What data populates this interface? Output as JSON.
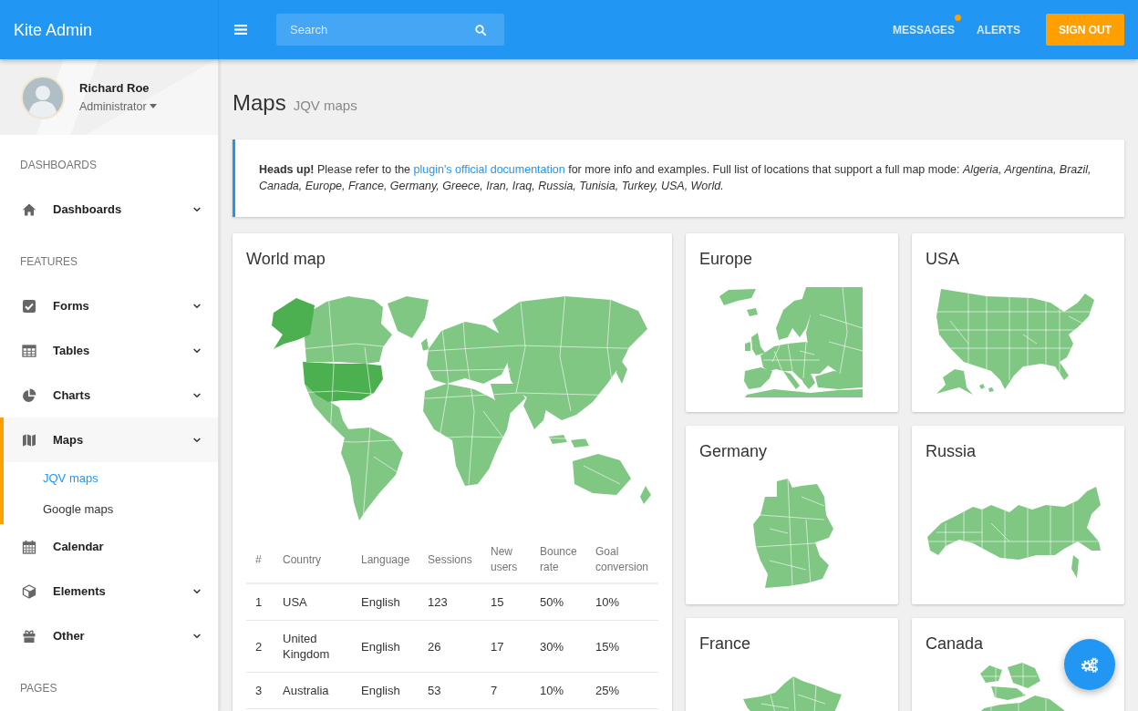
{
  "topbar": {
    "brand": "Kite Admin",
    "search": {
      "placeholder": "Search"
    },
    "links": [
      {
        "label": "MESSAGES",
        "unread": true
      },
      {
        "label": "ALERTS",
        "unread": false
      }
    ],
    "sign_out": "SIGN OUT"
  },
  "sidebar": {
    "profile": {
      "name": "Richard Roe",
      "role": "Administrator"
    },
    "sections": [
      {
        "heading": "DASHBOARDS",
        "items": [
          {
            "label": "Dashboards",
            "kind": "menu",
            "selected": false
          }
        ]
      },
      {
        "heading": "FEATURES",
        "items": [
          {
            "label": "Forms",
            "kind": "menu",
            "selected": false
          },
          {
            "label": "Tables",
            "kind": "menu",
            "selected": false
          },
          {
            "label": "Charts",
            "kind": "menu",
            "selected": false
          },
          {
            "label": "Maps",
            "kind": "menu",
            "selected": true,
            "children": [
              {
                "label": "JQV maps",
                "selected": true
              },
              {
                "label": "Google maps",
                "selected": false
              }
            ]
          },
          {
            "label": "Calendar",
            "kind": "link",
            "selected": false
          },
          {
            "label": "Elements",
            "kind": "menu",
            "selected": false
          },
          {
            "label": "Other",
            "kind": "menu",
            "selected": false
          }
        ]
      },
      {
        "heading": "PAGES"
      }
    ]
  },
  "page_header": {
    "title": "Maps",
    "subtitle": "JQV maps"
  },
  "alert": {
    "text_before": "**Heads up!** Please refer to the ",
    "link": "plugin's official documentation",
    "text_after": " for more info and examples. Full list of locations that support a full map mode: *Algeria, Argentina, Brazil, Canada, Europe, France, Germany, Greece, Iran, Iraq, Russia, Tunisia, Turkey, USA, World.*"
  },
  "world_map_card": {
    "title": "World map",
    "table": {
      "columns": [
        "#",
        "Country",
        "Language",
        "Sessions",
        "New users",
        "Bounce rate",
        "Goal conversion"
      ],
      "rows": [
        [
          "1",
          "USA",
          "English",
          "123",
          "15",
          "50%",
          "10%"
        ],
        [
          "2",
          "United Kingdom",
          "English",
          "26",
          "17",
          "30%",
          "15%"
        ],
        [
          "3",
          "Australia",
          "English",
          "53",
          "7",
          "10%",
          "25%"
        ]
      ]
    }
  },
  "map_cards": [
    {
      "title": "Europe"
    },
    {
      "title": "USA"
    },
    {
      "title": "Germany"
    },
    {
      "title": "Russia"
    },
    {
      "title": "France"
    },
    {
      "title": "Canada"
    }
  ]
}
